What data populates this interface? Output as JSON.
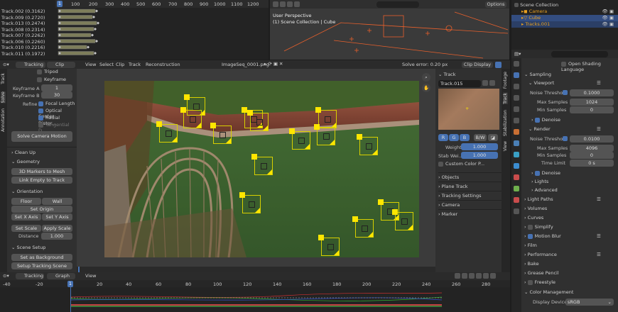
{
  "dopesheet": {
    "rows": [
      "Track.002 (0.3162)",
      "Track.009 (0.2720)",
      "Track.013 (0.2474)",
      "Track.008 (0.2314)",
      "Track.007 (0.2262)",
      "Track.006 (0.2260)",
      "Track.010 (0.2216)",
      "Track.011 (0.1972)"
    ],
    "ruler": [
      "1",
      "100",
      "200",
      "300",
      "400",
      "500",
      "600",
      "700",
      "800",
      "900",
      "1000",
      "1100",
      "1200"
    ]
  },
  "viewport3d": {
    "title": "User Perspective",
    "subtitle": "(1) Scene Collection | Cube",
    "options": "Options"
  },
  "outliner": {
    "root": "Scene Collection",
    "items": [
      "Camera",
      "Cube",
      "Tracks.001"
    ]
  },
  "clip": {
    "menu": [
      "Tracking",
      "Clip",
      "View",
      "Select",
      "Clip",
      "Track",
      "Reconstruction"
    ],
    "file": "ImageSeq_0001.png",
    "solve_error": "Solve error: 0.20 px",
    "clip_display": "Clip Display"
  },
  "solve": {
    "tripod": "Tripod",
    "keyframe": "Keyframe",
    "kfa_label": "Keyframe A",
    "kfa": "1",
    "kfb_label": "Keyframe B",
    "kfb": "30",
    "refine": "Refine",
    "focal": "Focal Length",
    "optical": "Optical Center",
    "radial": "Radial Distor...",
    "tangential": "Tangential D...",
    "solve_btn": "Solve Camera Motion"
  },
  "cleanup": "Clean Up",
  "geometry": {
    "title": "Geometry",
    "b1": "3D Markers to Mesh",
    "b2": "Link Empty to Track"
  },
  "orientation": {
    "title": "Orientation",
    "floor": "Floor",
    "wall": "Wall",
    "origin": "Set Origin",
    "xaxis": "Set X Axis",
    "yaxis": "Set Y Axis",
    "scale": "Set Scale",
    "apply": "Apply Scale",
    "dist_label": "Distance",
    "dist": "1.000"
  },
  "scene_setup": {
    "title": "Scene Setup",
    "bg": "Set as Background",
    "tracking": "Setup Tracking Scene"
  },
  "left_tabs": [
    "Track",
    "Solve",
    "Annotation"
  ],
  "track": {
    "title": "Track",
    "name": "Track.015",
    "r": "R",
    "g": "G",
    "b": "B",
    "bw": "B/W",
    "weight_label": "Weight",
    "weight": "1.000",
    "stab_label": "Stab Wei...",
    "stab": "1.000",
    "custom": "Custom Color P...",
    "sections": [
      "Objects",
      "Plane Track",
      "Tracking Settings",
      "Camera",
      "Marker"
    ]
  },
  "side_tabs": [
    "Footage",
    "Track",
    "Stabilization",
    "View"
  ],
  "props": {
    "open_shading": "Open Shading Language",
    "sampling": "Sampling",
    "viewport": "Viewport",
    "noise_label": "Noise Threshold",
    "noise_vp": "0.1000",
    "max_samples_label": "Max Samples",
    "max_vp": "1024",
    "min_samples_label": "Min Samples",
    "min_vp": "0",
    "denoise": "Denoise",
    "render": "Render",
    "noise_r": "0.0100",
    "max_r": "4096",
    "min_r": "0",
    "time_label": "Time Limit",
    "time": "0 s",
    "adv": "Advanced",
    "lights": "Lights",
    "light_paths": "Light Paths",
    "volumes": "Volumes",
    "curves": "Curves",
    "simplify": "Simplify",
    "motion_blur": "Motion Blur",
    "film": "Film",
    "performance": "Performance",
    "bake": "Bake",
    "grease": "Grease Pencil",
    "freestyle": "Freestyle",
    "color_mgmt": "Color Management",
    "display_label": "Display Device",
    "display": "sRGB"
  },
  "graph": {
    "menu": [
      "Tracking",
      "Graph",
      "View"
    ],
    "ruler": [
      "-40",
      "-20",
      "1",
      "20",
      "40",
      "60",
      "80",
      "100",
      "120",
      "140",
      "160",
      "180",
      "200",
      "220",
      "240",
      "260",
      "280"
    ]
  }
}
